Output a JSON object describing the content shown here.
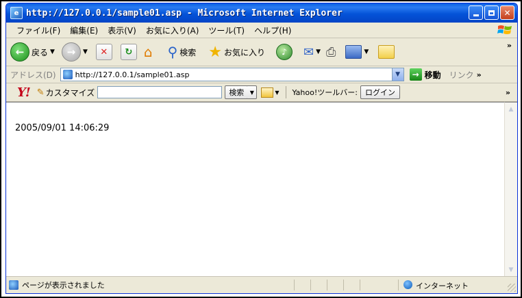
{
  "window": {
    "title": "http://127.0.0.1/sample01.asp - Microsoft Internet Explorer"
  },
  "menubar": {
    "items": [
      "ファイル(F)",
      "編集(E)",
      "表示(V)",
      "お気に入り(A)",
      "ツール(T)",
      "ヘルプ(H)"
    ]
  },
  "toolbar": {
    "back_label": "戻る",
    "search_label": "検索",
    "favorites_label": "お気に入り",
    "chevron": "»"
  },
  "addressbar": {
    "label": "アドレス(D)",
    "url": "http://127.0.0.1/sample01.asp",
    "go_label": "移動",
    "links_label": "リンク",
    "links_chevron": "»"
  },
  "yahoo_toolbar": {
    "logo": "Y!",
    "customize_label": "カスタマイズ",
    "search_value": "",
    "search_button": "検索",
    "toolbar_label": "Yahoo!ツールバー:",
    "login_button": "ログイン",
    "chevron": "»"
  },
  "content": {
    "datetime": "2005/09/01 14:06:29"
  },
  "statusbar": {
    "text": "ページが表示されました",
    "zone": "インターネット"
  }
}
